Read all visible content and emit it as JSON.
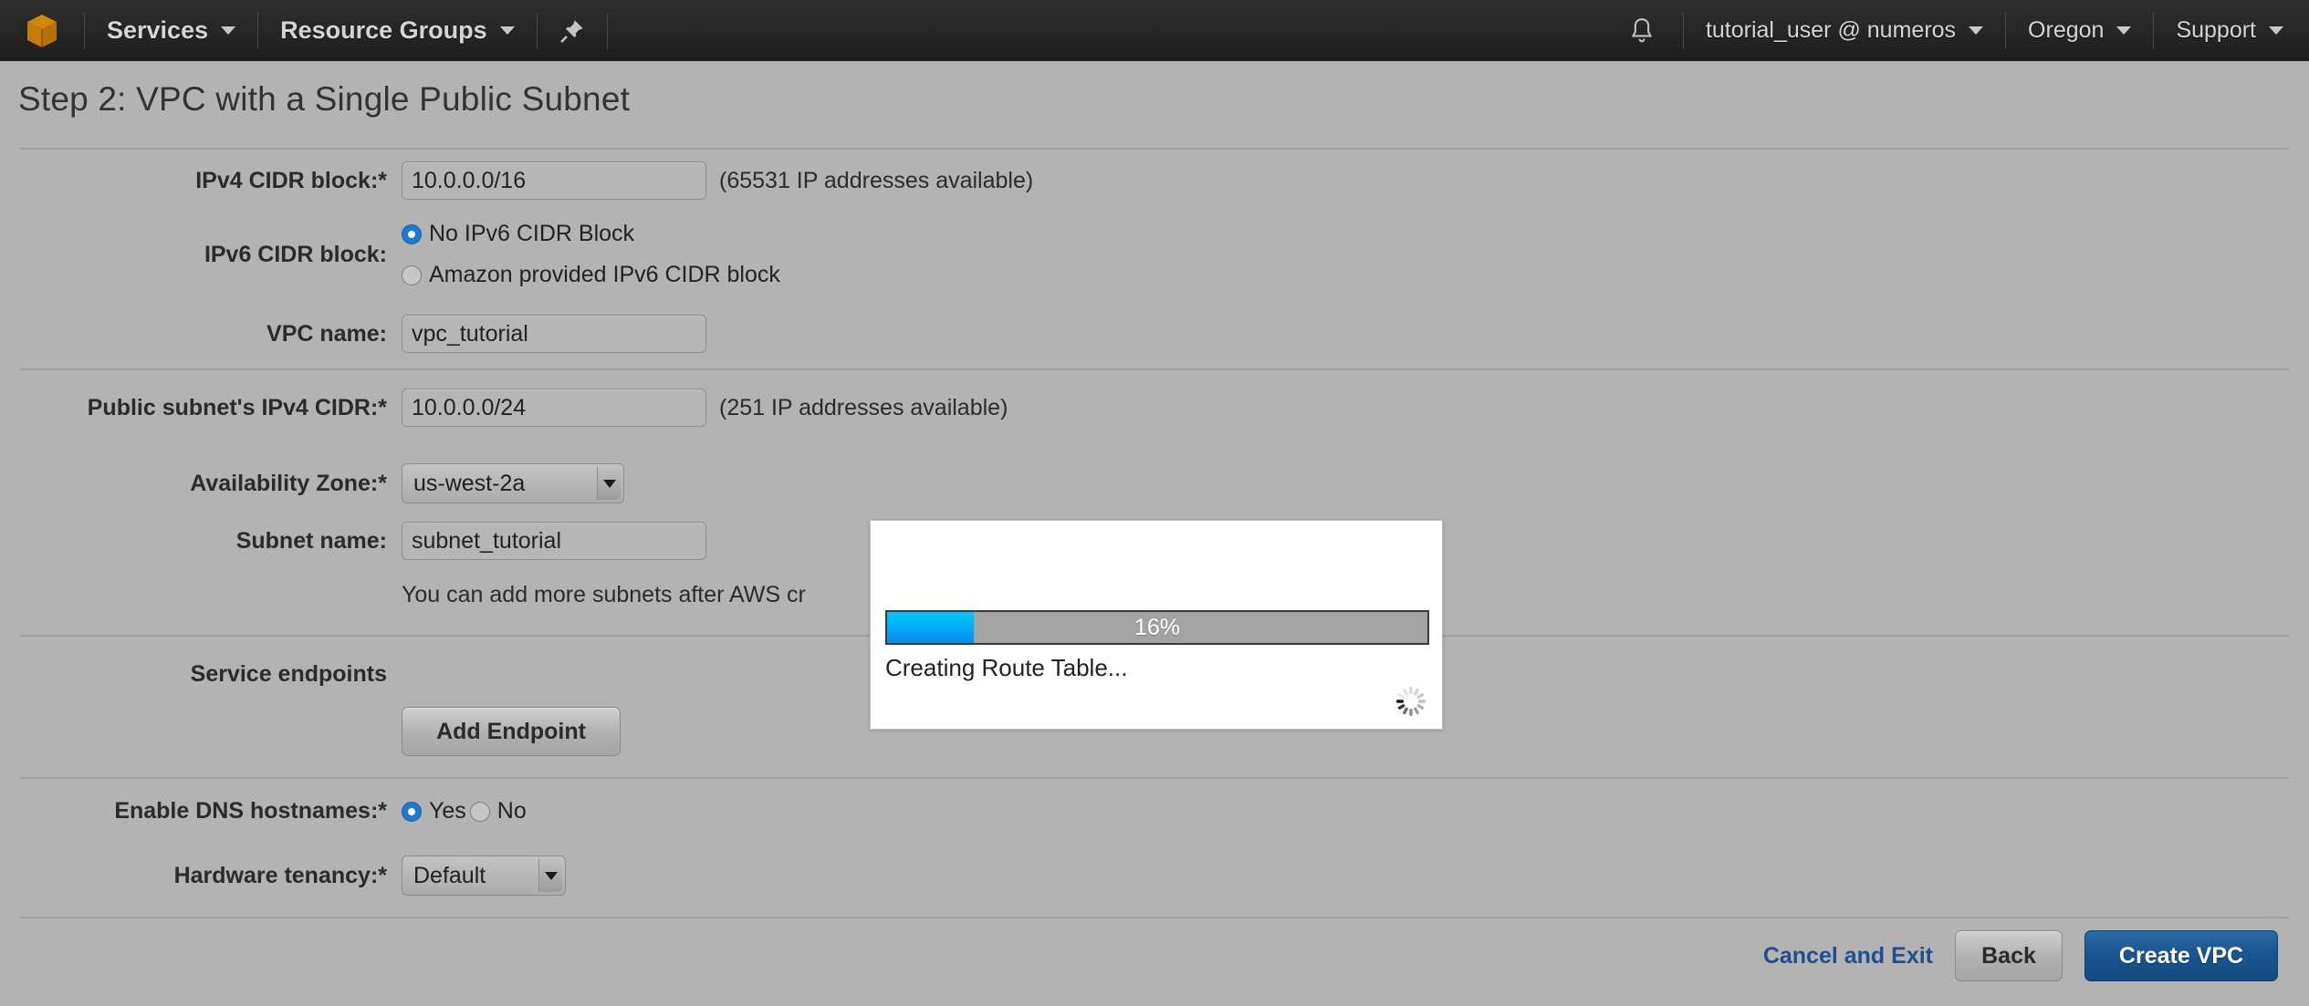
{
  "navbar": {
    "logo_icon": "aws-cube-icon",
    "services_label": "Services",
    "resource_groups_label": "Resource Groups",
    "pin_icon": "pushpin-icon",
    "bell_icon": "bell-icon",
    "account_label": "tutorial_user @ numeros",
    "region_label": "Oregon",
    "support_label": "Support",
    "caret_icon": "chevron-down-icon"
  },
  "page": {
    "title": "Step 2: VPC with a Single Public Subnet"
  },
  "form": {
    "ipv4_cidr_label": "IPv4 CIDR block:*",
    "ipv4_cidr_value": "10.0.0.0/16",
    "ipv4_cidr_hint": "(65531 IP addresses available)",
    "ipv6_cidr_label": "IPv6 CIDR block:",
    "ipv6_option_none": "No IPv6 CIDR Block",
    "ipv6_option_amazon": "Amazon provided IPv6 CIDR block",
    "ipv6_selected": "No IPv6 CIDR Block",
    "vpc_name_label": "VPC name:",
    "vpc_name_value": "vpc_tutorial",
    "subnet_cidr_label": "Public subnet's IPv4 CIDR:*",
    "subnet_cidr_value": "10.0.0.0/24",
    "subnet_cidr_hint": "(251 IP addresses available)",
    "az_label": "Availability Zone:*",
    "az_value": "us-west-2a",
    "subnet_name_label": "Subnet name:",
    "subnet_name_value": "subnet_tutorial",
    "subnet_note": "You can add more subnets after AWS cr",
    "service_endpoints_label": "Service endpoints",
    "add_endpoint_label": "Add Endpoint",
    "dns_label": "Enable DNS hostnames:*",
    "dns_yes": "Yes",
    "dns_no": "No",
    "dns_selected": "Yes",
    "tenancy_label": "Hardware tenancy:*",
    "tenancy_value": "Default"
  },
  "modal": {
    "progress_percent": "16%",
    "progress_value": 16,
    "status_text": "Creating Route Table...",
    "spinner_icon": "loading-spinner-icon"
  },
  "footer": {
    "cancel_label": "Cancel and Exit",
    "back_label": "Back",
    "create_label": "Create VPC"
  },
  "colors": {
    "page_background": "#b3b3b3",
    "navbar_background": "#262626",
    "accent_blue": "#1a5590",
    "link_blue": "#1d4f91",
    "radio_selected": "#1f78d1",
    "progress_fill_top": "#00c8fb",
    "progress_fill_bottom": "#0b8bec",
    "logo_orange": "#cc7a0a"
  }
}
